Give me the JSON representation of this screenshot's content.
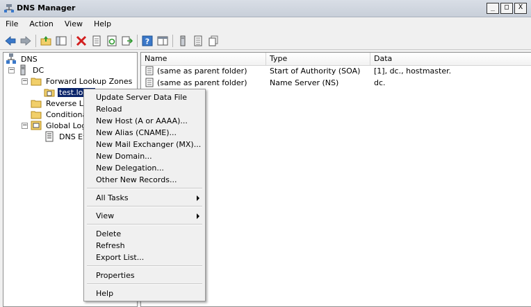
{
  "window": {
    "title": "DNS Manager",
    "minimize": "_",
    "maximize": "□",
    "close": "X"
  },
  "menubar": [
    "File",
    "Action",
    "View",
    "Help"
  ],
  "tree": {
    "root": "DNS",
    "server": "DC",
    "forward_zones": "Forward Lookup Zones",
    "selected_zone": "test.local",
    "reverse_zones": "Reverse Lo",
    "conditional": "Conditional",
    "global_logs": "Global Logs",
    "dns_events": "DNS Ev"
  },
  "list": {
    "columns": [
      "Name",
      "Type",
      "Data"
    ],
    "rows": [
      {
        "name": "(same as parent folder)",
        "type": "Start of Authority (SOA)",
        "data": "[1], dc., hostmaster."
      },
      {
        "name": "(same as parent folder)",
        "type": "Name Server (NS)",
        "data": "dc."
      }
    ]
  },
  "context_menu": {
    "update": "Update Server Data File",
    "reload": "Reload",
    "new_host": "New Host (A or AAAA)...",
    "new_alias": "New Alias (CNAME)...",
    "new_mx": "New Mail Exchanger (MX)...",
    "new_domain": "New Domain...",
    "new_delegation": "New Delegation...",
    "other_records": "Other New Records...",
    "all_tasks": "All Tasks",
    "view": "View",
    "delete": "Delete",
    "refresh": "Refresh",
    "export": "Export List...",
    "properties": "Properties",
    "help": "Help"
  },
  "colors": {
    "selection": "#0a246a",
    "accent_blue": "#3a78c9",
    "delete_red": "#d21f1f",
    "folder": "#f1cf6a"
  }
}
